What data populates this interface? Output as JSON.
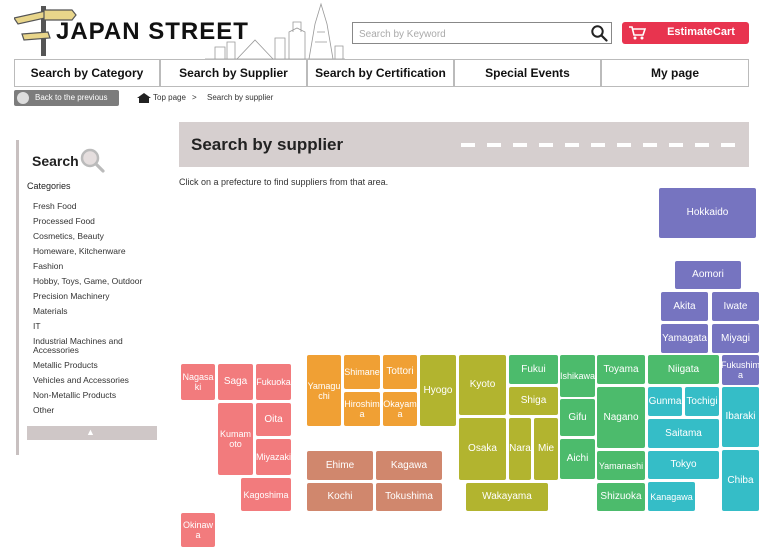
{
  "header": {
    "logo_text": "JAPAN STREET",
    "search_placeholder": "Search by Keyword",
    "cart_label": "EstimateCart"
  },
  "nav": {
    "tabs": [
      "Search by Category",
      "Search by Supplier",
      "Search by Certification",
      "Special Events",
      "My page"
    ]
  },
  "breadcrumb": {
    "back_label": "Back to the previous",
    "top": "Top page",
    "separator": ">",
    "current": "Search by supplier"
  },
  "sidebar": {
    "title": "Search",
    "categories_label": "Categories",
    "items": [
      "Fresh Food",
      "Processed Food",
      "Cosmetics, Beauty",
      "Homeware, Kitchenware",
      "Fashion",
      "Hobby, Toys, Game, Outdoor",
      "Precision Machinery",
      "Materials",
      "IT",
      "Industrial Machines and Accessories",
      "Metallic Products",
      "Vehicles and Accessories",
      "Non-Metallic Products",
      "Other"
    ],
    "collapse_icon": "▲"
  },
  "main": {
    "title": "Search by supplier",
    "instruction": "Click on a prefecture to find suppliers from that area."
  },
  "colors": {
    "accent_red": "#e8344f",
    "kyushu": "#f27b7d",
    "chugoku": "#f0a034",
    "shikoku": "#d0876d",
    "kinki": "#b2b42f",
    "chubu": "#4cbb6c",
    "kanto": "#35bdc7",
    "tohoku_hokkaido": "#7674c0"
  },
  "prefectures": {
    "hokkaido": "Hokkaido",
    "aomori": "Aomori",
    "akita": "Akita",
    "iwate": "Iwate",
    "yamagata": "Yamagata",
    "miyagi": "Miyagi",
    "fukushima": "Fukushim\na",
    "niigata": "Niigata",
    "toyama": "Toyama",
    "ishikawa": "Ishikawa",
    "fukui": "Fukui",
    "nagano": "Nagano",
    "gifu": "Gifu",
    "aichi": "Aichi",
    "yamanashi": "Yamanashi",
    "shizuoka": "Shizuoka",
    "gunma": "Gunma",
    "tochigi": "Tochigi",
    "ibaraki": "Ibaraki",
    "saitama": "Saitama",
    "tokyo": "Tokyo",
    "chiba": "Chiba",
    "kanagawa": "Kanagawa",
    "kyoto": "Kyoto",
    "shiga": "Shiga",
    "hyogo": "Hyogo",
    "osaka": "Osaka",
    "nara": "Nara",
    "mie": "Mie",
    "wakayama": "Wakayama",
    "tottori": "Tottori",
    "shimane": "Shimane",
    "okayama": "Okayama",
    "hiroshima": "Hiroshima",
    "yamaguchi": "Yamaguchi",
    "ehime": "Ehime",
    "kagawa": "Kagawa",
    "kochi": "Kochi",
    "tokushima": "Tokushima",
    "fukuoka": "Fukuoka",
    "saga": "Saga",
    "nagasaki": "Nagasaki",
    "oita": "Oita",
    "kumamoto": "Kumamoto",
    "miyazaki": "Miyazaki",
    "kagoshima": "Kagoshima",
    "okinawa": "Okinawa"
  }
}
